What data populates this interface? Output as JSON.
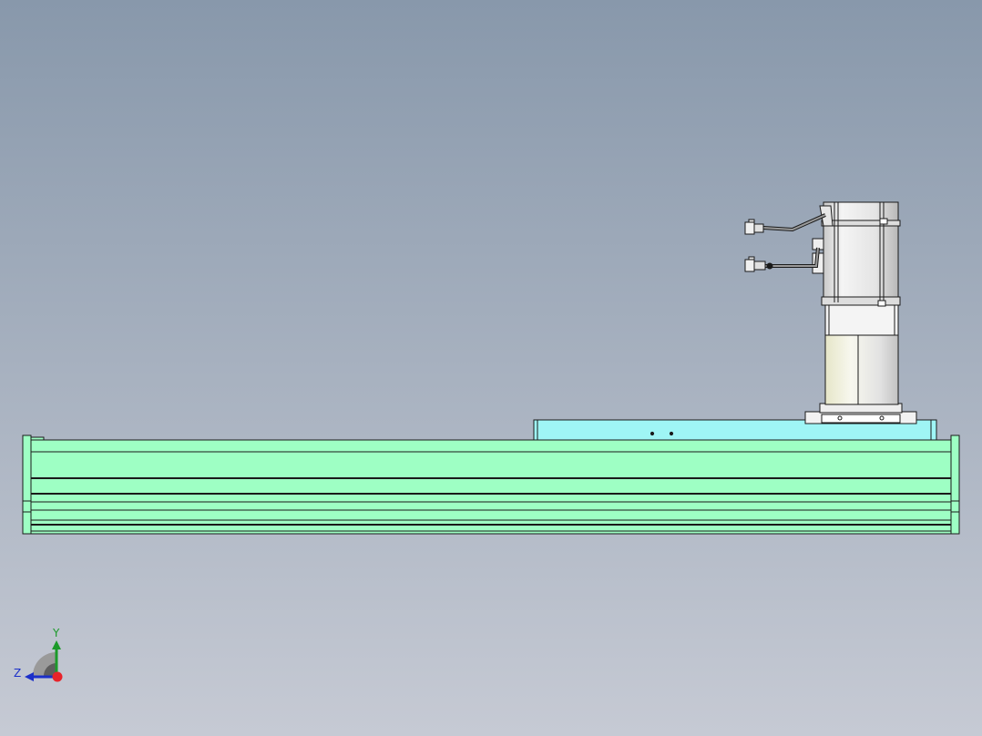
{
  "viewport": {
    "background_top": "#8898ab",
    "background_bottom": "#c6cad4"
  },
  "model": {
    "base_color": "#9effc4",
    "carriage_color": "#9ff5f5",
    "motor_color": "#ececec",
    "edge_color": "#1a1a1a"
  },
  "triad": {
    "y_label": "Y",
    "z_label": "Z",
    "y_color": "#1c9a2a",
    "z_color": "#1b2fc9",
    "origin_color": "#e8232a"
  }
}
